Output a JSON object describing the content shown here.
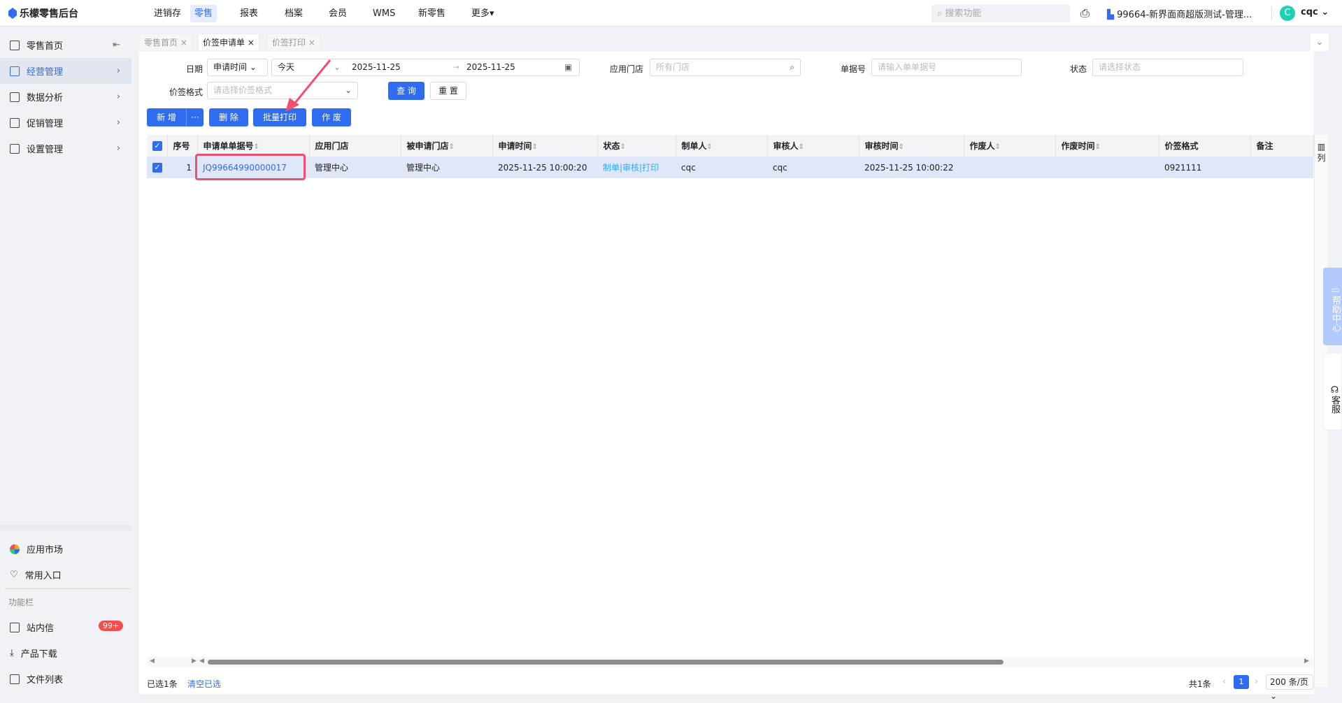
{
  "app": {
    "title": "乐檬零售后台"
  },
  "nav": [
    "进销存",
    "零售",
    "报表",
    "档案",
    "会员",
    "WMS",
    "新零售",
    "更多▾"
  ],
  "search_placeholder": "搜索功能",
  "store": "99664-新界面商超版测试-管理...",
  "user": {
    "initial": "C",
    "name": "cqc"
  },
  "sidebar": {
    "items": [
      "零售首页",
      "经营管理",
      "数据分析",
      "促销管理",
      "设置管理"
    ],
    "bottom": [
      "应用市场",
      "常用入口"
    ],
    "section": "功能栏",
    "tools": [
      "站内信",
      "产品下载",
      "文件列表"
    ],
    "badge": "99+"
  },
  "tabs": [
    "零售首页 ×",
    "价签申请单 ×",
    "价签打印 ×"
  ],
  "filters": {
    "date_label": "日期",
    "date_type": "申请时间",
    "date_preset": "今天",
    "date_from": "2025-11-25",
    "date_to": "2025-11-25",
    "store_label": "应用门店",
    "store_placeholder": "所有门店",
    "no_label": "单据号",
    "no_placeholder": "请输入单单据号",
    "status_label": "状态",
    "status_placeholder": "请选择状态",
    "format_label": "价签格式",
    "format_placeholder": "请选择价签格式",
    "query": "查 询",
    "reset": "重 置"
  },
  "actions": {
    "add": "新 增",
    "more": "···",
    "delete": "删 除",
    "batch_print": "批量打印",
    "void": "作 废"
  },
  "table": {
    "columns": [
      "序号",
      "申请单单据号",
      "应用门店",
      "被申请门店",
      "申请时间",
      "状态",
      "制单人",
      "审核人",
      "审核时间",
      "作废人",
      "作废时间",
      "价签格式",
      "备注"
    ],
    "rows": [
      {
        "idx": "1",
        "no": "JQ99664990000017",
        "store": "管理中心",
        "target": "管理中心",
        "time": "2025-11-25 10:00:20",
        "status": "制单|审核|打印",
        "maker": "cqc",
        "auditor": "cqc",
        "audit_time": "2025-11-25 10:00:22",
        "voider": "",
        "void_time": "",
        "format": "0921111",
        "note": ""
      }
    ],
    "col_btn": "列"
  },
  "footer": {
    "selected": "已选1条",
    "clear": "清空已选",
    "total": "共1条",
    "page": "1",
    "page_size": "200 条/页"
  },
  "float": {
    "help": "帮助中心",
    "service": "客服"
  }
}
